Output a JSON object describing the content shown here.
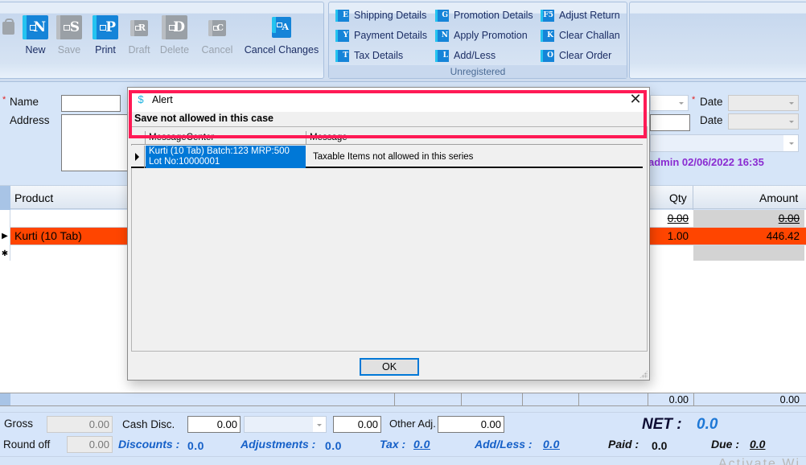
{
  "ribbon": {
    "main_buttons": [
      {
        "label": "New",
        "glyph": "N",
        "enabled": true
      },
      {
        "label": "Save",
        "glyph": "S",
        "enabled": false
      },
      {
        "label": "Print",
        "glyph": "P",
        "enabled": true
      },
      {
        "label": "Draft",
        "glyph": "R",
        "enabled": false
      },
      {
        "label": "Delete",
        "glyph": "D",
        "enabled": false
      },
      {
        "label": "Cancel",
        "glyph": "C",
        "enabled": false
      },
      {
        "label": "Cancel Changes",
        "glyph": "A",
        "enabled": true
      }
    ],
    "small_buttons": [
      {
        "label": "Shipping Details",
        "glyph": "E"
      },
      {
        "label": "Payment Details",
        "glyph": "Y"
      },
      {
        "label": "Tax Details",
        "glyph": "T"
      },
      {
        "label": "Promotion Details",
        "glyph": "G"
      },
      {
        "label": "Apply Promotion",
        "glyph": "N"
      },
      {
        "label": "Add/Less",
        "glyph": "L"
      },
      {
        "label": "Adjust Return",
        "glyph": "F5"
      },
      {
        "label": "Clear Challan",
        "glyph": "K"
      },
      {
        "label": "Clear Order",
        "glyph": "O"
      }
    ],
    "group_caption": "Unregistered"
  },
  "form": {
    "name_label": "Name",
    "address_label": "Address",
    "date_label_1": "Date",
    "date_label_2": "Date",
    "required_mark": "*",
    "audit_text": "admin 02/06/2022 16:35"
  },
  "grid": {
    "headers": {
      "product": "Product",
      "qty": "Qty",
      "amount": "Amount"
    },
    "rows": [
      {
        "product": "",
        "qty": "0.00",
        "amount": "0.00",
        "selected": false
      },
      {
        "product": "Kurti (10 Tab)",
        "qty": "1.00",
        "amount": "446.42",
        "selected": true
      },
      {
        "product": "",
        "qty": "",
        "amount": "",
        "selected": false,
        "new_row": true
      }
    ],
    "totals": {
      "qty": "0.00",
      "amount": "0.00"
    },
    "selected_color": "#ff4500"
  },
  "footer": {
    "gross_label": "Gross",
    "gross_value": "0.00",
    "round_off_label": "Round off",
    "round_off_value": "0.00",
    "cash_disc_label": "Cash Disc.",
    "cash_disc_value": "0.00",
    "cash_disc_pct_value": "0.00",
    "other_adj_label": "Other Adj.",
    "other_adj_value": "0.00",
    "discounts_label": "Discounts :",
    "discounts_value": "0.0",
    "adjustments_label": "Adjustments :",
    "adjustments_value": "0.0",
    "tax_label": "Tax :",
    "tax_value": "0.0",
    "addless_label": "Add/Less :",
    "addless_value": "0.0",
    "net_label": "NET :",
    "net_value": "0.0",
    "paid_label": "Paid :",
    "paid_value": "0.0",
    "due_label": "Due :",
    "due_value": "0.0",
    "watermark": "Activate Wi"
  },
  "dialog": {
    "title": "Alert",
    "message": "Save not allowed in this case",
    "columns": [
      "MessageCenter",
      "Message"
    ],
    "rows": [
      {
        "message_center": "Kurti (10 Tab) Batch:123 MRP:500 Lot No:10000001",
        "message": "Taxable Items not allowed in this series"
      }
    ],
    "ok_label": "OK",
    "close_glyph": "✕",
    "highlight_color": "#ff1a55"
  }
}
